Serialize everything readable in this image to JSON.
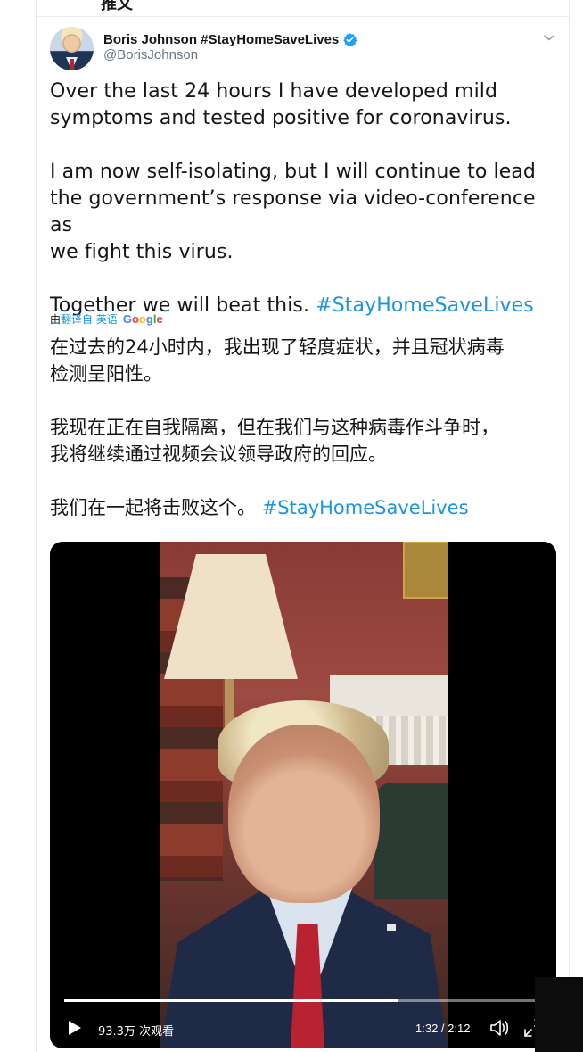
{
  "header": {
    "partial_text": "推文"
  },
  "author": {
    "display_name": "Boris Johnson #StayHomeSaveLives",
    "handle": "@BorisJohnson",
    "verified": true,
    "verified_color": "#1da1f2",
    "avatar_icon": "avatar"
  },
  "tweet": {
    "line1": "Over the last 24 hours I have developed mild",
    "line2": "symptoms and tested positive for coronavirus.",
    "line3": "I am now self-isolating, but I will continue to lead",
    "line4": "the government’s response via video-conference as",
    "line5": "we fight this virus.",
    "line6_text": "Together we will beat this. ",
    "hashtag": "#StayHomeSaveLives",
    "hashtag_color": "#1b95e0"
  },
  "translation": {
    "prefix": "由",
    "link": "翻译自 英语",
    "google": [
      "G",
      "o",
      "o",
      "g",
      "l",
      "e"
    ],
    "zh_line1": "在过去的24小时内，我出现了轻度症状，并且冠状病毒",
    "zh_line2": "检测呈阳性。",
    "zh_line3": "我现在正在自我隔离，但在我们与这种病毒作斗争时，",
    "zh_line4": "我将继续通过视频会议领导政府的回应。",
    "zh_line5_text": "我们在一起将击败这个。 ",
    "zh_hashtag": "#StayHomeSaveLives"
  },
  "video": {
    "views": "93.3万 次观看",
    "time": "1:32 / 2:12",
    "progress": 0.697
  }
}
